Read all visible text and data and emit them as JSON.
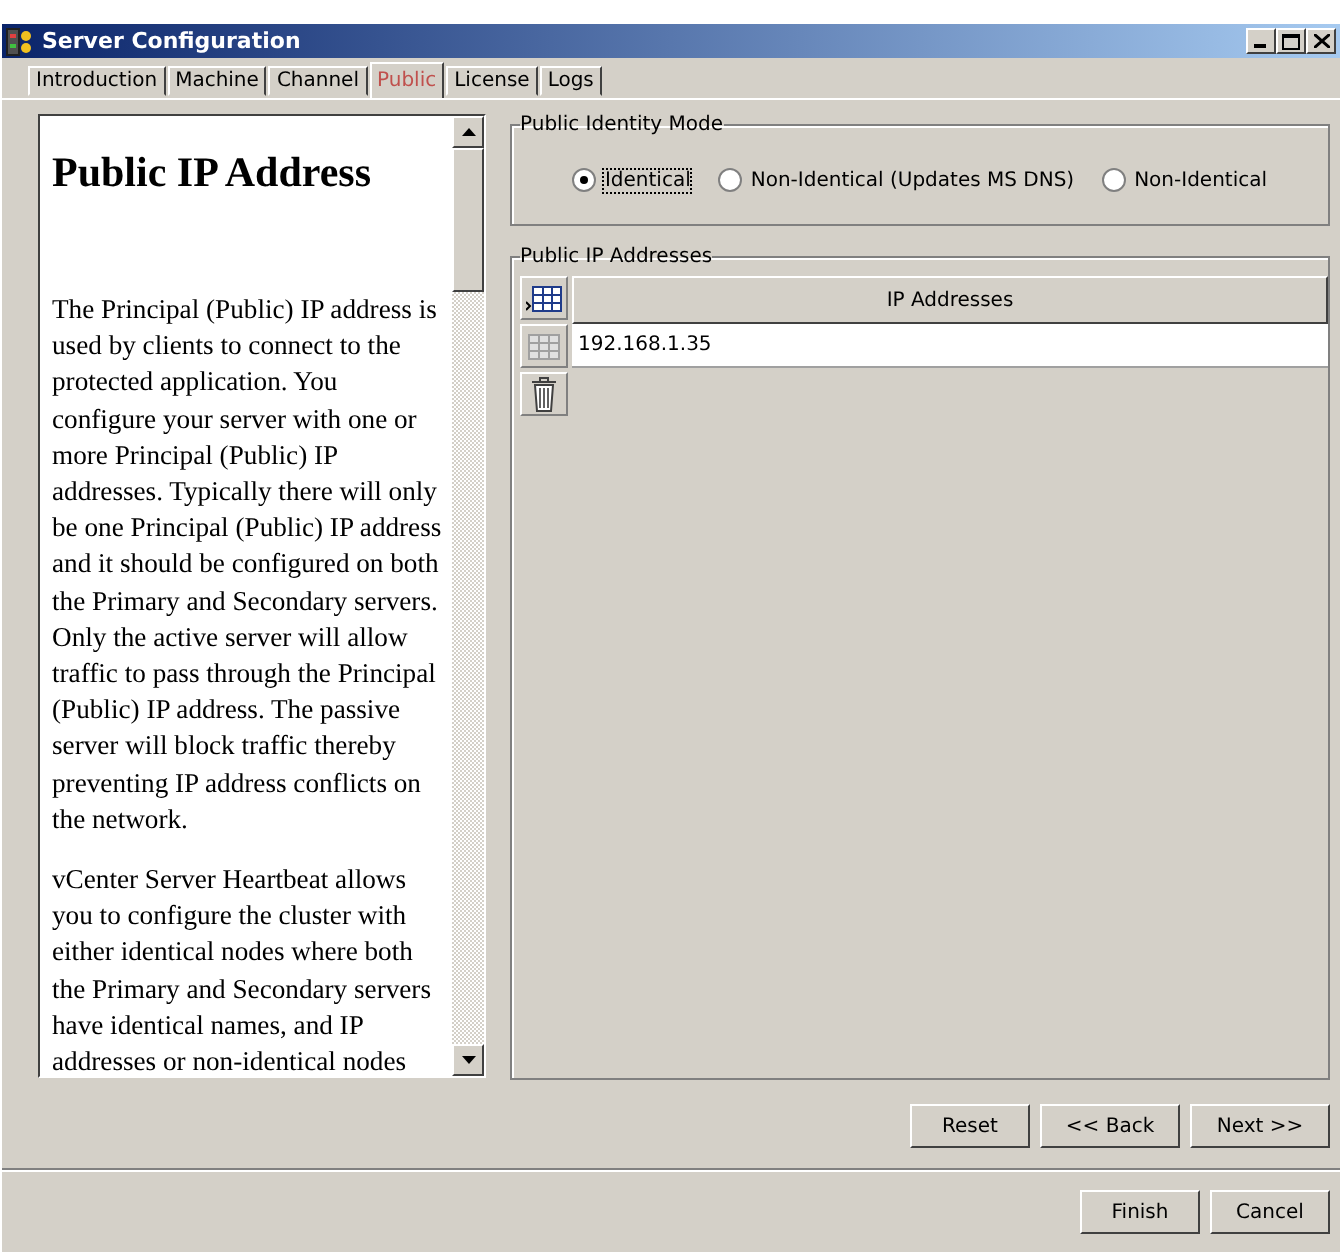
{
  "window": {
    "title": "Server Configuration"
  },
  "tabs": [
    {
      "label": "Introduction",
      "selected": false
    },
    {
      "label": "Machine",
      "selected": false
    },
    {
      "label": "Channel",
      "selected": false
    },
    {
      "label": "Public",
      "selected": true
    },
    {
      "label": "License",
      "selected": false
    },
    {
      "label": "Logs",
      "selected": false
    }
  ],
  "help": {
    "heading": "Public IP Address",
    "paragraphs": [
      "The Principal (Public) IP address is used by clients to connect to the protected application. You configure your server with one or more Principal (Public) IP addresses. Typically there will only be one Principal (Public) IP address and it should be configured on both the Primary and Secondary servers. Only the active server will allow traffic to pass through the Principal (Public) IP address. The passive server will block traffic thereby preventing IP address conflicts on the network.",
      "vCenter Server Heartbeat allows you to configure the cluster with either identical nodes where both the Primary and Secondary servers have identical names, and IP addresses or non-identical nodes"
    ]
  },
  "identity_mode": {
    "title": "Public Identity Mode",
    "options": [
      {
        "label": "Identical",
        "selected": true
      },
      {
        "label": "Non-Identical (Updates MS DNS)",
        "selected": false
      },
      {
        "label": "Non-Identical",
        "selected": false
      }
    ]
  },
  "addresses": {
    "title": "Public IP Addresses",
    "tools": [
      {
        "kind": "add",
        "disabled": false
      },
      {
        "kind": "remove",
        "disabled": true
      },
      {
        "kind": "delete",
        "disabled": false
      }
    ],
    "column": "IP Addresses",
    "rows": [
      "192.168.1.35"
    ]
  },
  "nav_buttons": [
    "Reset",
    "<< Back",
    "Next >>"
  ],
  "footer_buttons": [
    "Finish",
    "Cancel"
  ]
}
